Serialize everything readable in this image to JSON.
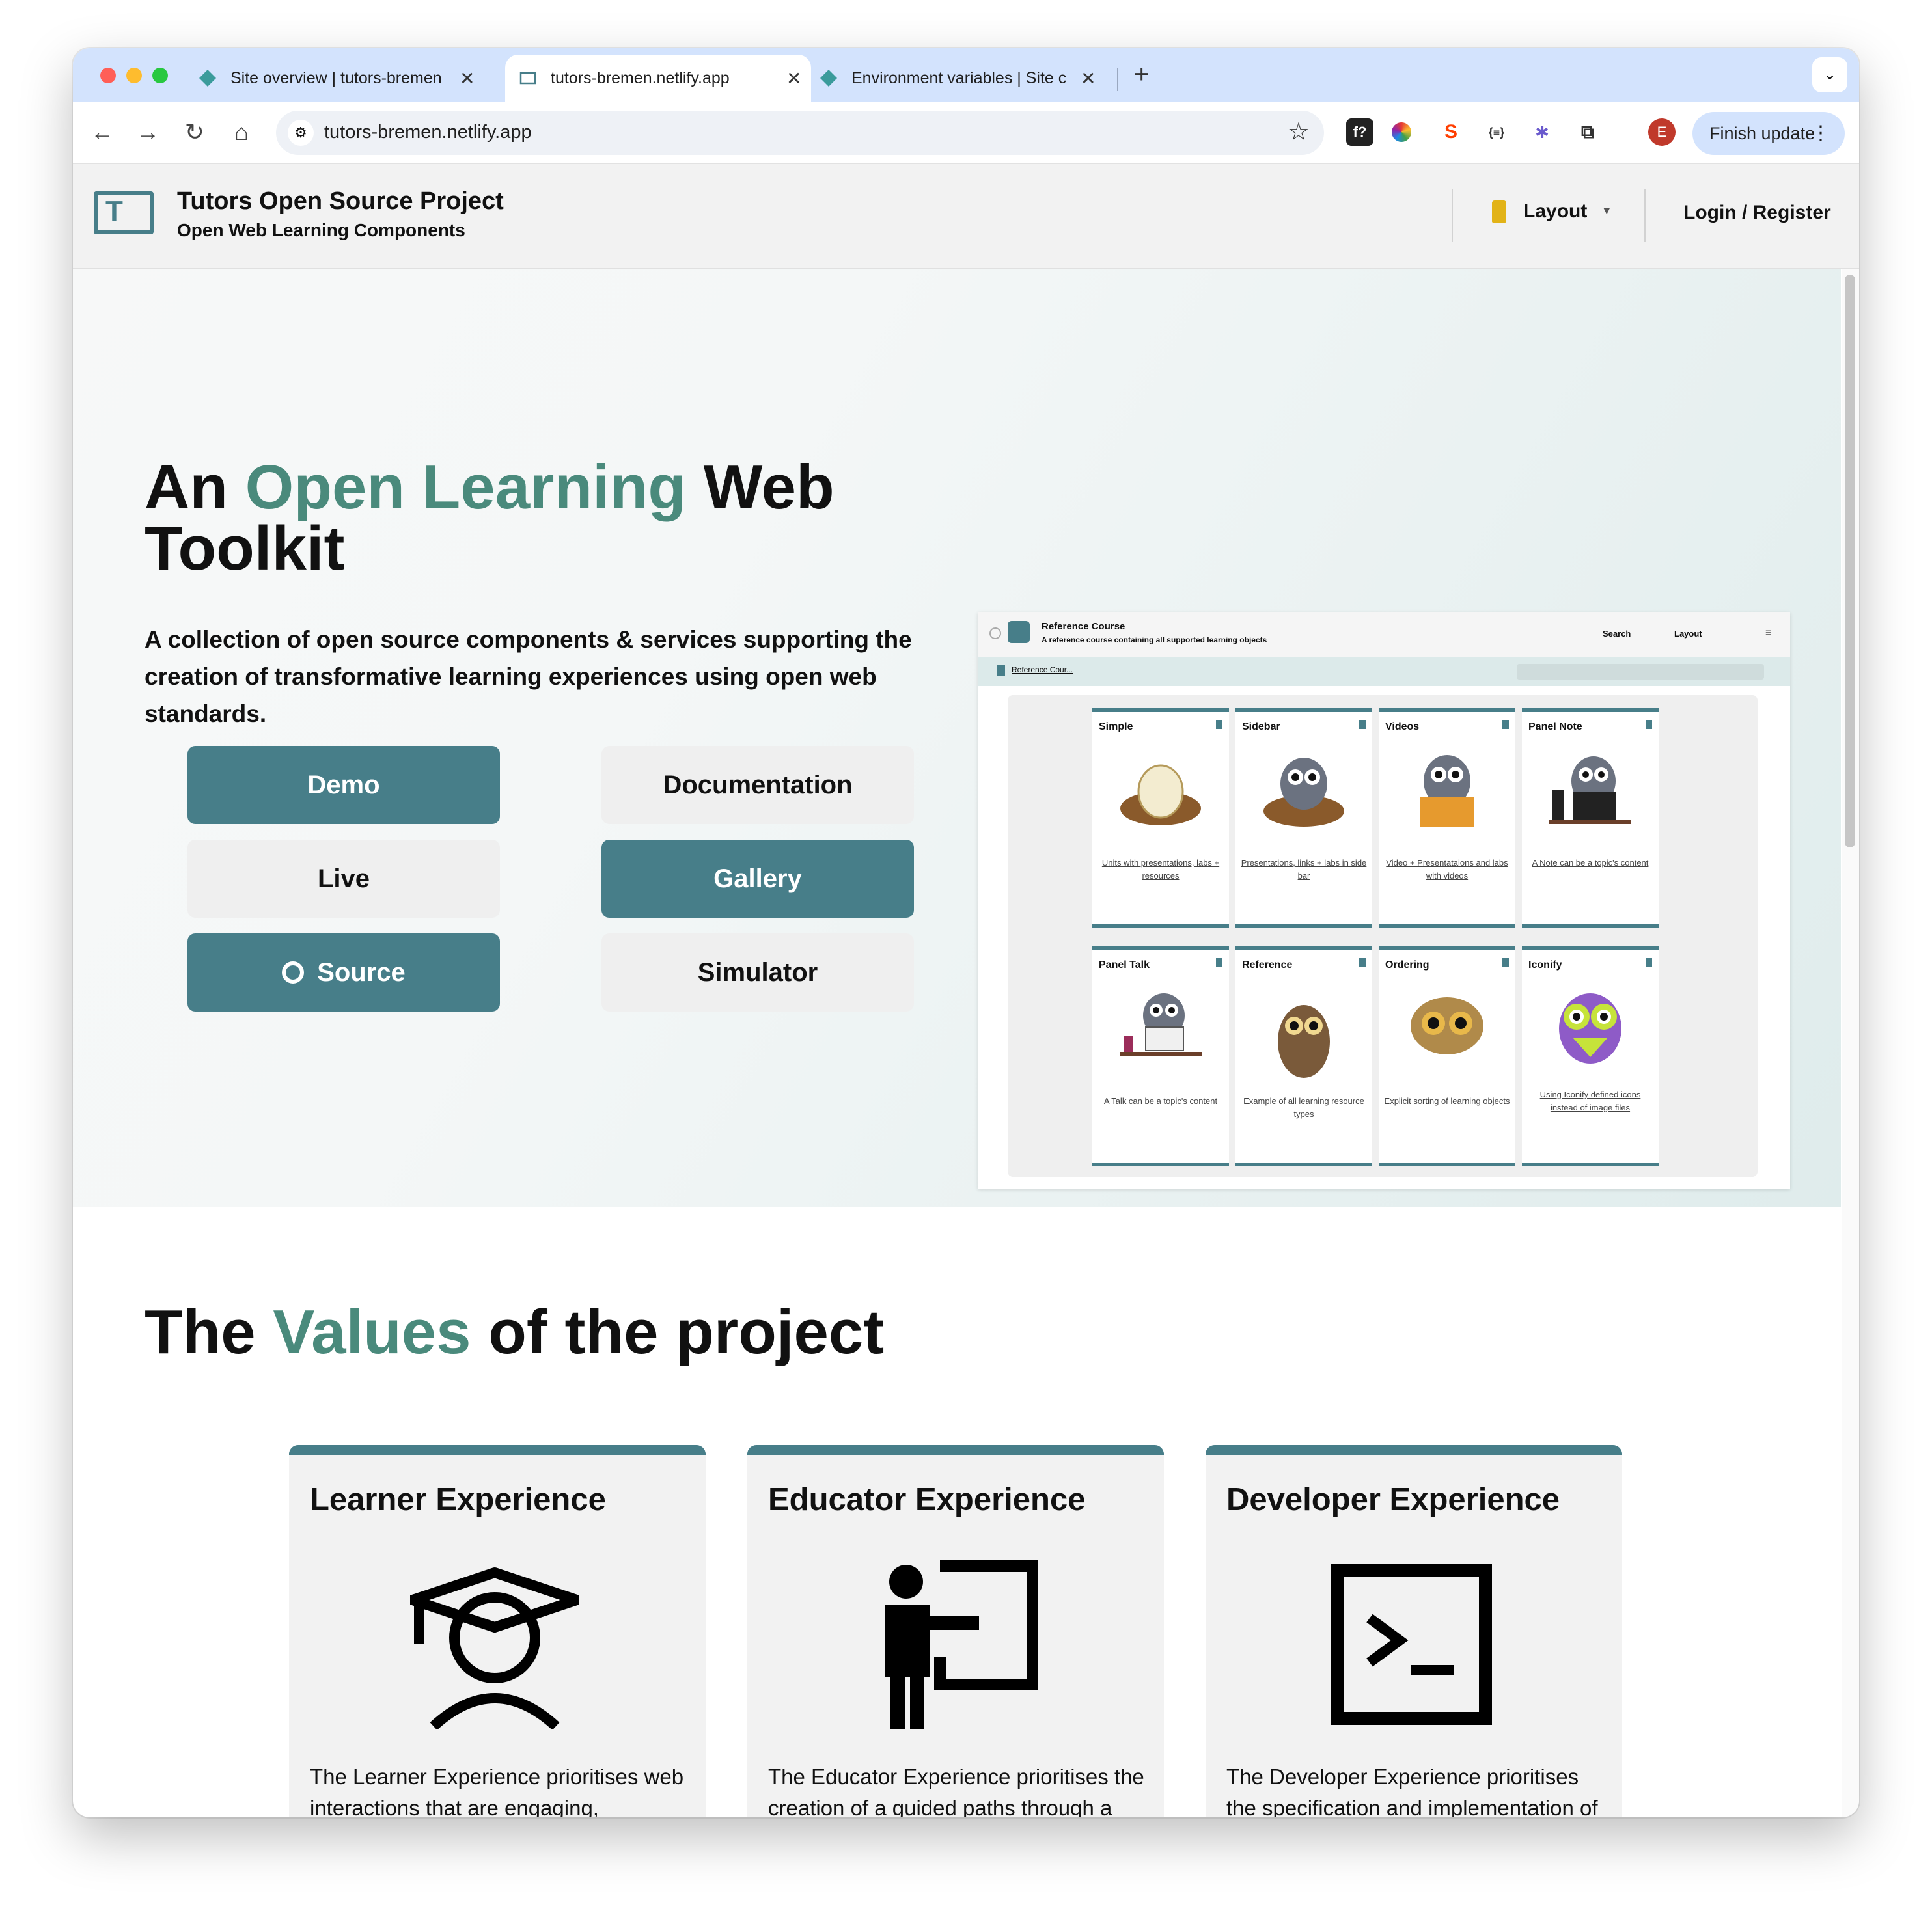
{
  "browser": {
    "tabs": [
      {
        "title": "Site overview | tutors-bremen",
        "active": false
      },
      {
        "title": "tutors-bremen.netlify.app",
        "active": true
      },
      {
        "title": "Environment variables | Site c",
        "active": false
      }
    ],
    "new_tab": "+",
    "url": "tutors-bremen.netlify.app",
    "finish_update": "Finish update",
    "profile_initial": "E",
    "extensions": [
      "f?",
      "color-wheel",
      "svelte",
      "{≡}",
      "bee",
      "puzzle"
    ]
  },
  "header": {
    "logo_text": "T",
    "title": "Tutors Open Source Project",
    "subtitle": "Open Web Learning Components",
    "layout": "Layout",
    "login": "Login / Register"
  },
  "hero": {
    "title_pre": "An ",
    "title_accent": "Open Learning",
    "title_post": " Web Toolkit",
    "lede": "A collection of open source components & services supporting the creation of transformative learning experiences using open web standards.",
    "buttons": {
      "demo": "Demo",
      "documentation": "Documentation",
      "live": "Live",
      "gallery": "Gallery",
      "source": "Source",
      "simulator": "Simulator"
    }
  },
  "preview": {
    "course_title": "Reference Course",
    "course_subtitle": "A reference course containing all supported learning objects",
    "search": "Search",
    "layout": "Layout",
    "breadcrumb": "Reference Cour...",
    "cards": [
      {
        "title": "Simple",
        "desc": "Units with presentations, labs + resources",
        "art": "egg-nest"
      },
      {
        "title": "Sidebar",
        "desc": "Presentations, links + labs in side bar",
        "art": "owl-nest"
      },
      {
        "title": "Videos",
        "desc": "Video + Presentataions and labs with videos",
        "art": "owl-book"
      },
      {
        "title": "Panel Note",
        "desc": "A Note can be a topic's content",
        "art": "owl-laptop"
      },
      {
        "title": "Panel Talk",
        "desc": "A Talk can be a topic's content",
        "art": "owl-desk"
      },
      {
        "title": "Reference",
        "desc": "Example of all learning resource types",
        "art": "brown-owl"
      },
      {
        "title": "Ordering",
        "desc": "Explicit sorting of learning objects",
        "art": "owl-face"
      },
      {
        "title": "Iconify",
        "desc": "Using Iconify defined icons instead of image files",
        "art": "purple-owl"
      }
    ]
  },
  "values": {
    "title_pre": "The ",
    "title_accent": "Values",
    "title_post": " of the project",
    "cards": [
      {
        "title": "Learner Experience",
        "icon": "graduate-icon",
        "body": "The Learner Experience prioritises web interactions that are engaging, contextual, linkable, searchable, accessible and responsive. In"
      },
      {
        "title": "Educator Experience",
        "icon": "teacher-board-icon",
        "body": "The Educator Experience prioritises the creation of a guided paths through a curriculum via the creation of learning materials that are"
      },
      {
        "title": "Developer Experience",
        "icon": "terminal-icon",
        "body": "The Developer Experience prioritises the specification and implementation of robust, well documented, loosely coupled components & services"
      }
    ]
  },
  "colors": {
    "accent": "#477e89",
    "accent_text": "#4a8a7c",
    "layout_pin": "#e2b317"
  }
}
